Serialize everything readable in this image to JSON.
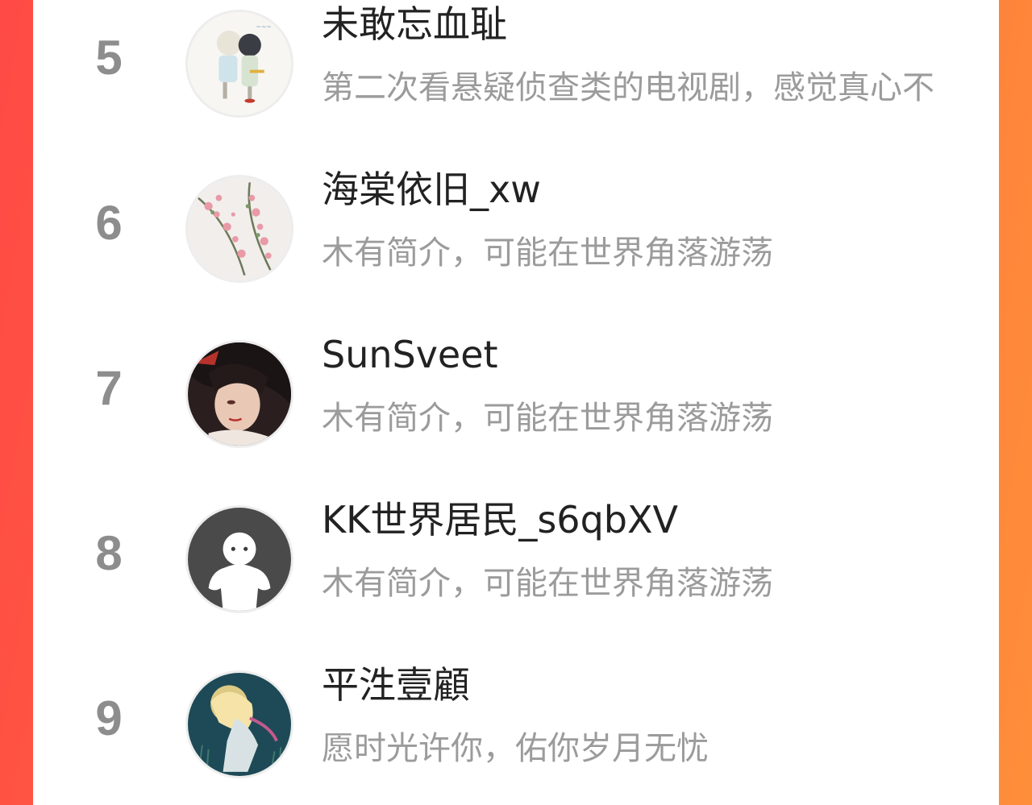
{
  "rankings": [
    {
      "rank": "5",
      "name": "未敢忘血耻",
      "bio": "第二次看悬疑侦查类的电视剧，感觉真心不",
      "avatar_icon": "anime-illustration-avatar"
    },
    {
      "rank": "6",
      "name": "海棠依旧_xw",
      "bio": "木有简介，可能在世界角落游荡",
      "avatar_icon": "flower-blossom-avatar"
    },
    {
      "rank": "7",
      "name": "SunSveet",
      "bio": "木有简介，可能在世界角落游荡",
      "avatar_icon": "anime-portrait-avatar"
    },
    {
      "rank": "8",
      "name": "KK世界居民_s6qbXV",
      "bio": "木有简介，可能在世界角落游荡",
      "avatar_icon": "default-ghost-avatar"
    },
    {
      "rank": "9",
      "name": "平泩壹顧",
      "bio": "愿时光许你，佑你岁月无忧",
      "avatar_icon": "dark-teal-illustration-avatar"
    }
  ],
  "colors": {
    "background_gradient_start": "#ff4a45",
    "background_gradient_end": "#ff8e3a",
    "rank_number": "#8d8d8d",
    "name_text": "#222222",
    "bio_text": "#9b9b9b"
  }
}
